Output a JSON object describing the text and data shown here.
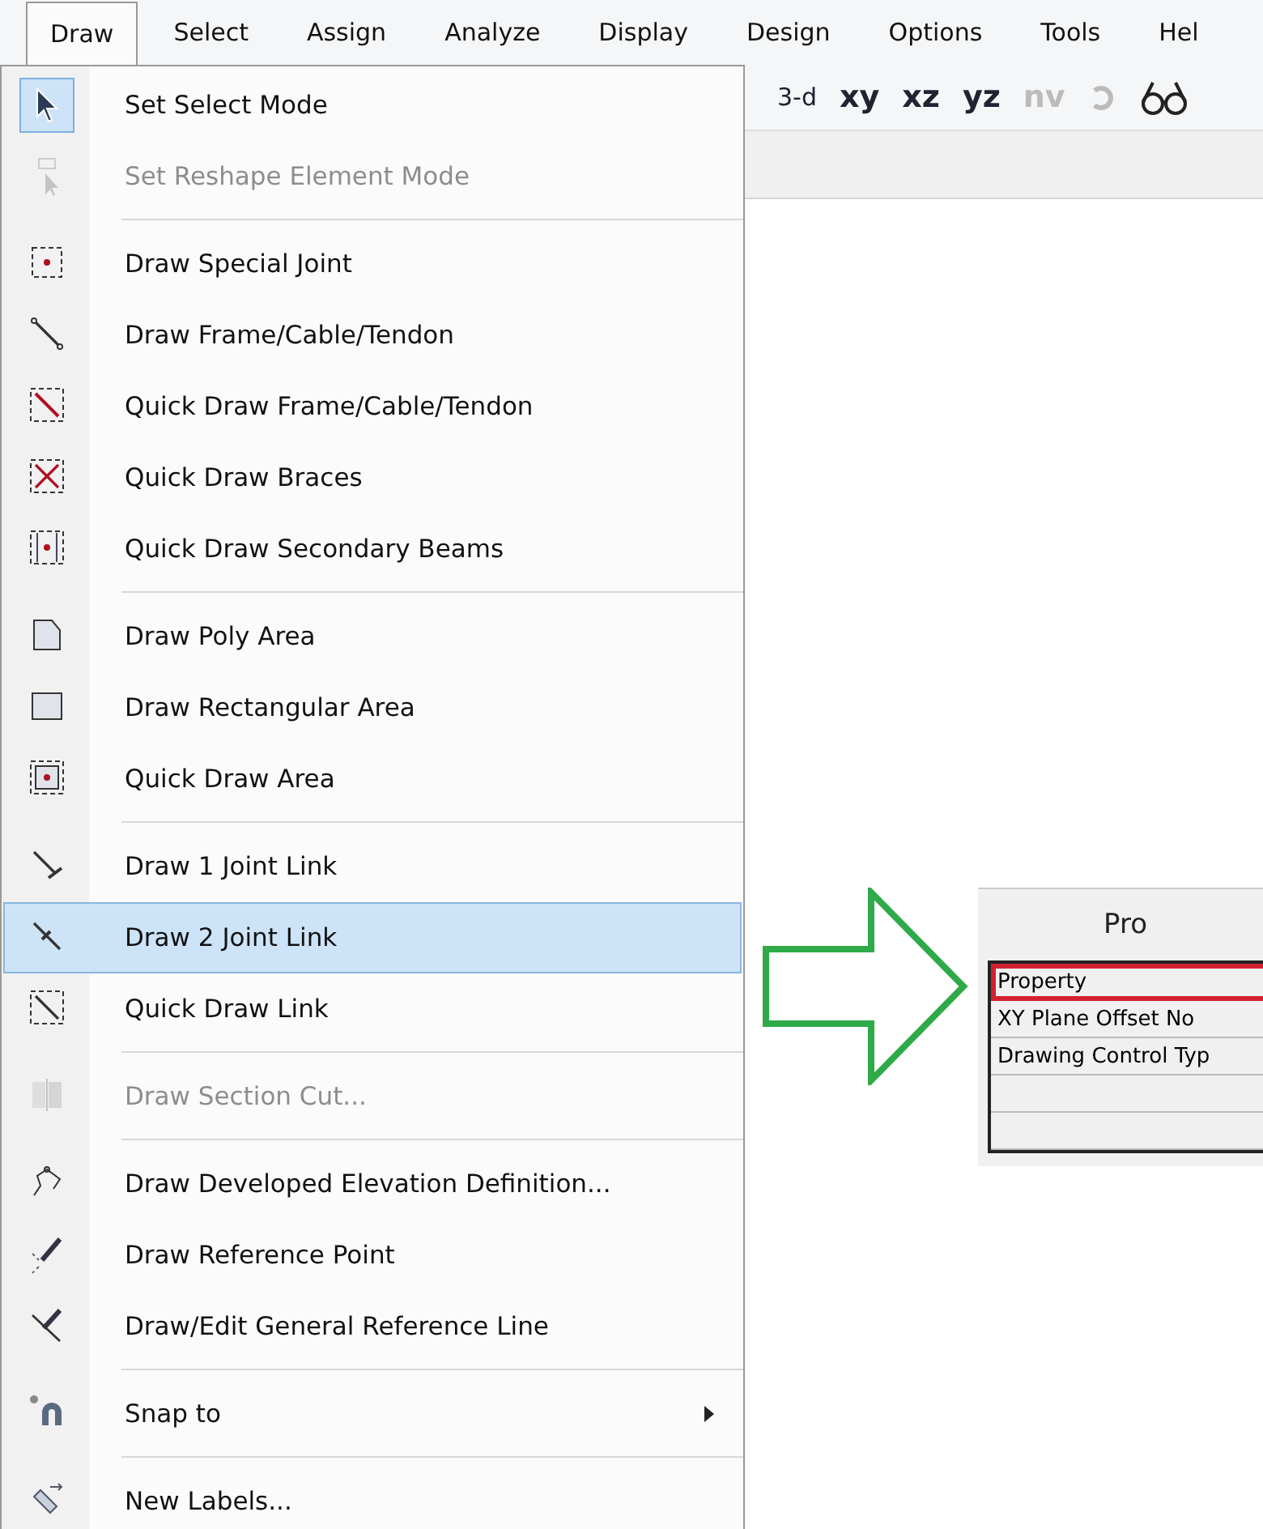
{
  "menu_bar": [
    {
      "label": "Draw",
      "selected": true
    },
    {
      "label": "Select",
      "selected": false
    },
    {
      "label": "Assign",
      "selected": false
    },
    {
      "label": "Analyze",
      "selected": false
    },
    {
      "label": "Display",
      "selected": false
    },
    {
      "label": "Design",
      "selected": false
    },
    {
      "label": "Options",
      "selected": false
    },
    {
      "label": "Tools",
      "selected": false
    },
    {
      "label": "Hel",
      "selected": false
    }
  ],
  "toolbar": [
    {
      "label": "3-d",
      "kind": "plain",
      "disabled": false
    },
    {
      "label": "xy",
      "kind": "bold",
      "disabled": false
    },
    {
      "label": "xz",
      "kind": "bold",
      "disabled": false
    },
    {
      "label": "yz",
      "kind": "bold",
      "disabled": false
    },
    {
      "label": "nv",
      "kind": "bold",
      "disabled": true
    }
  ],
  "draw_menu": [
    [
      {
        "label": "Set Select Mode",
        "disabled": false,
        "selected": false,
        "checked": true,
        "submenu": false
      },
      {
        "label": "Set Reshape Element Mode",
        "disabled": true,
        "selected": false,
        "checked": false,
        "submenu": false
      }
    ],
    [
      {
        "label": "Draw Special Joint",
        "disabled": false,
        "selected": false,
        "checked": false,
        "submenu": false
      },
      {
        "label": "Draw Frame/Cable/Tendon",
        "disabled": false,
        "selected": false,
        "checked": false,
        "submenu": false
      },
      {
        "label": "Quick Draw Frame/Cable/Tendon",
        "disabled": false,
        "selected": false,
        "checked": false,
        "submenu": false
      },
      {
        "label": "Quick Draw Braces",
        "disabled": false,
        "selected": false,
        "checked": false,
        "submenu": false
      },
      {
        "label": "Quick Draw Secondary Beams",
        "disabled": false,
        "selected": false,
        "checked": false,
        "submenu": false
      }
    ],
    [
      {
        "label": "Draw Poly Area",
        "disabled": false,
        "selected": false,
        "checked": false,
        "submenu": false
      },
      {
        "label": "Draw Rectangular Area",
        "disabled": false,
        "selected": false,
        "checked": false,
        "submenu": false
      },
      {
        "label": "Quick Draw Area",
        "disabled": false,
        "selected": false,
        "checked": false,
        "submenu": false
      }
    ],
    [
      {
        "label": "Draw 1 Joint Link",
        "disabled": false,
        "selected": false,
        "checked": false,
        "submenu": false
      },
      {
        "label": "Draw 2 Joint Link",
        "disabled": false,
        "selected": true,
        "checked": false,
        "submenu": false
      },
      {
        "label": "Quick Draw Link",
        "disabled": false,
        "selected": false,
        "checked": false,
        "submenu": false
      }
    ],
    [
      {
        "label": "Draw Section Cut...",
        "disabled": true,
        "selected": false,
        "checked": false,
        "submenu": false
      }
    ],
    [
      {
        "label": "Draw Developed Elevation Definition...",
        "disabled": false,
        "selected": false,
        "checked": false,
        "submenu": false
      },
      {
        "label": "Draw Reference Point",
        "disabled": false,
        "selected": false,
        "checked": false,
        "submenu": false
      },
      {
        "label": "Draw/Edit General Reference Line",
        "disabled": false,
        "selected": false,
        "checked": false,
        "submenu": false
      }
    ],
    [
      {
        "label": "Snap to",
        "disabled": false,
        "selected": false,
        "checked": false,
        "submenu": true
      }
    ],
    [
      {
        "label": "New Labels...",
        "disabled": false,
        "selected": false,
        "checked": false,
        "submenu": false
      }
    ]
  ],
  "properties_panel": {
    "title": "Pro",
    "rows": [
      {
        "label": "Property",
        "highlighted": true
      },
      {
        "label": "XY Plane Offset No",
        "highlighted": false
      },
      {
        "label": "Drawing Control Typ",
        "highlighted": false
      },
      {
        "highlighted": false
      },
      {
        "highlighted": false
      }
    ]
  }
}
